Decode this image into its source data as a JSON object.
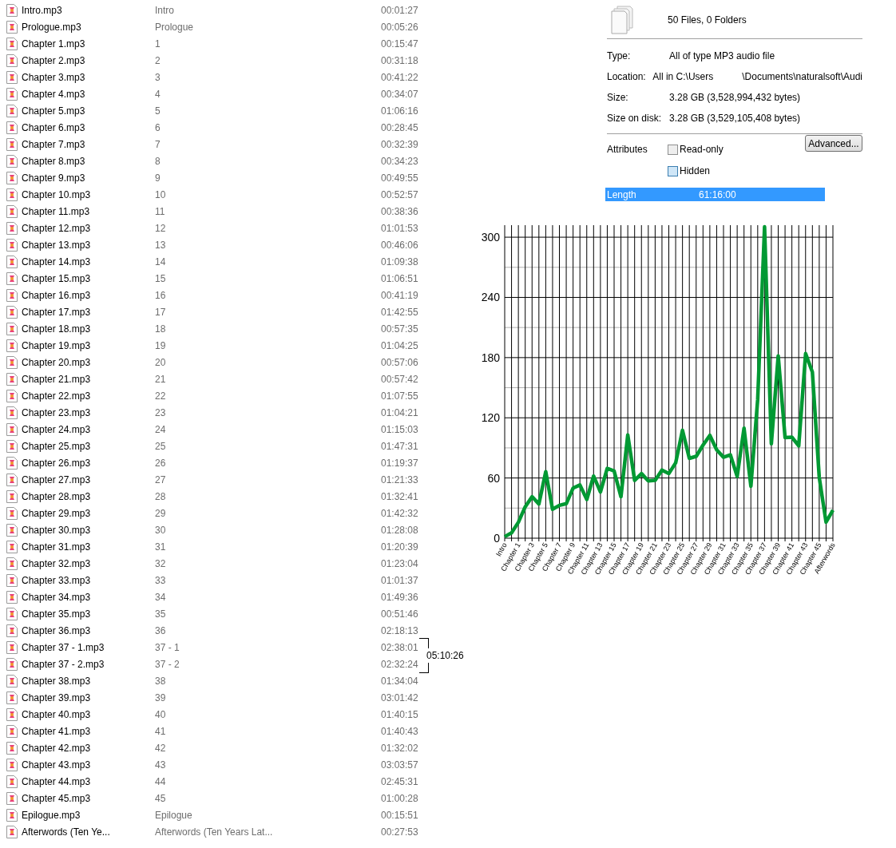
{
  "files": [
    {
      "name": "Intro.mp3",
      "title": "Intro",
      "length": "00:01:27"
    },
    {
      "name": "Prologue.mp3",
      "title": "Prologue",
      "length": "00:05:26"
    },
    {
      "name": "Chapter 1.mp3",
      "title": "1",
      "length": "00:15:47"
    },
    {
      "name": "Chapter 2.mp3",
      "title": "2",
      "length": "00:31:18"
    },
    {
      "name": "Chapter 3.mp3",
      "title": "3",
      "length": "00:41:22"
    },
    {
      "name": "Chapter 4.mp3",
      "title": "4",
      "length": "00:34:07"
    },
    {
      "name": "Chapter 5.mp3",
      "title": "5",
      "length": "01:06:16"
    },
    {
      "name": "Chapter 6.mp3",
      "title": "6",
      "length": "00:28:45"
    },
    {
      "name": "Chapter 7.mp3",
      "title": "7",
      "length": "00:32:39"
    },
    {
      "name": "Chapter 8.mp3",
      "title": "8",
      "length": "00:34:23"
    },
    {
      "name": "Chapter 9.mp3",
      "title": "9",
      "length": "00:49:55"
    },
    {
      "name": "Chapter 10.mp3",
      "title": "10",
      "length": "00:52:57"
    },
    {
      "name": "Chapter 11.mp3",
      "title": "11",
      "length": "00:38:36"
    },
    {
      "name": "Chapter 12.mp3",
      "title": "12",
      "length": "01:01:53"
    },
    {
      "name": "Chapter 13.mp3",
      "title": "13",
      "length": "00:46:06"
    },
    {
      "name": "Chapter 14.mp3",
      "title": "14",
      "length": "01:09:38"
    },
    {
      "name": "Chapter 15.mp3",
      "title": "15",
      "length": "01:06:51"
    },
    {
      "name": "Chapter 16.mp3",
      "title": "16",
      "length": "00:41:19"
    },
    {
      "name": "Chapter 17.mp3",
      "title": "17",
      "length": "01:42:55"
    },
    {
      "name": "Chapter 18.mp3",
      "title": "18",
      "length": "00:57:35"
    },
    {
      "name": "Chapter 19.mp3",
      "title": "19",
      "length": "01:04:25"
    },
    {
      "name": "Chapter 20.mp3",
      "title": "20",
      "length": "00:57:06"
    },
    {
      "name": "Chapter 21.mp3",
      "title": "21",
      "length": "00:57:42"
    },
    {
      "name": "Chapter 22.mp3",
      "title": "22",
      "length": "01:07:55"
    },
    {
      "name": "Chapter 23.mp3",
      "title": "23",
      "length": "01:04:21"
    },
    {
      "name": "Chapter 24.mp3",
      "title": "24",
      "length": "01:15:03"
    },
    {
      "name": "Chapter 25.mp3",
      "title": "25",
      "length": "01:47:31"
    },
    {
      "name": "Chapter 26.mp3",
      "title": "26",
      "length": "01:19:37"
    },
    {
      "name": "Chapter 27.mp3",
      "title": "27",
      "length": "01:21:33"
    },
    {
      "name": "Chapter 28.mp3",
      "title": "28",
      "length": "01:32:41"
    },
    {
      "name": "Chapter 29.mp3",
      "title": "29",
      "length": "01:42:32"
    },
    {
      "name": "Chapter 30.mp3",
      "title": "30",
      "length": "01:28:08"
    },
    {
      "name": "Chapter 31.mp3",
      "title": "31",
      "length": "01:20:39"
    },
    {
      "name": "Chapter 32.mp3",
      "title": "32",
      "length": "01:23:04"
    },
    {
      "name": "Chapter 33.mp3",
      "title": "33",
      "length": "01:01:37"
    },
    {
      "name": "Chapter 34.mp3",
      "title": "34",
      "length": "01:49:36"
    },
    {
      "name": "Chapter 35.mp3",
      "title": "35",
      "length": "00:51:46"
    },
    {
      "name": "Chapter 36.mp3",
      "title": "36",
      "length": "02:18:13"
    },
    {
      "name": "Chapter 37 - 1.mp3",
      "title": "37 - 1",
      "length": "02:38:01",
      "group_total": "05:10:26"
    },
    {
      "name": "Chapter 37 - 2.mp3",
      "title": "37 - 2",
      "length": "02:32:24"
    },
    {
      "name": "Chapter 38.mp3",
      "title": "38",
      "length": "01:34:04"
    },
    {
      "name": "Chapter 39.mp3",
      "title": "39",
      "length": "03:01:42"
    },
    {
      "name": "Chapter 40.mp3",
      "title": "40",
      "length": "01:40:15"
    },
    {
      "name": "Chapter 41.mp3",
      "title": "41",
      "length": "01:40:43"
    },
    {
      "name": "Chapter 42.mp3",
      "title": "42",
      "length": "01:32:02"
    },
    {
      "name": "Chapter 43.mp3",
      "title": "43",
      "length": "03:03:57"
    },
    {
      "name": "Chapter 44.mp3",
      "title": "44",
      "length": "02:45:31"
    },
    {
      "name": "Chapter 45.mp3",
      "title": "45",
      "length": "01:00:28"
    },
    {
      "name": "Epilogue.mp3",
      "title": "Epilogue",
      "length": "00:15:51"
    },
    {
      "name": "Afterwords (Ten Ye...",
      "title": "Afterwords (Ten Years Lat...",
      "length": "00:27:53"
    }
  ],
  "properties": {
    "summary": "50 Files, 0 Folders",
    "fields": [
      {
        "label": "Type:",
        "parts": [
          "All of type MP3 audio file"
        ]
      },
      {
        "label": "Location:",
        "parts": [
          "All in C:\\Users",
          "\\Documents\\naturalsoft\\Audi"
        ]
      },
      {
        "label": "Size:",
        "parts": [
          "3.28 GB (3,528,994,432 bytes)"
        ]
      },
      {
        "label": "Size on disk:",
        "parts": [
          "3.28 GB (3,529,105,408 bytes)"
        ]
      }
    ],
    "attributes_label": "Attributes",
    "checkboxes": [
      {
        "label": "Read-only",
        "checked": false,
        "focused": false
      },
      {
        "label": "Hidden",
        "checked": false,
        "focused": true
      }
    ],
    "advanced_button": "Advanced...",
    "length_row": {
      "label": "Length",
      "value": "61:16:00",
      "selected": true
    }
  },
  "chart": {
    "chart_data": {
      "type": "line",
      "categories": [
        "Intro",
        null,
        "Chapter 1",
        null,
        "Chapter 3",
        null,
        "Chapter 5",
        null,
        "Chapter 7",
        null,
        "Chapter 9",
        null,
        "Chapter 11",
        null,
        "Chapter 13",
        null,
        "Chapter 15",
        null,
        "Chapter 17",
        null,
        "Chapter 19",
        null,
        "Chapter 21",
        null,
        "Chapter 23",
        null,
        "Chapter 25",
        null,
        "Chapter 27",
        null,
        "Chapter 29",
        null,
        "Chapter 31",
        null,
        "Chapter 33",
        null,
        "Chapter 35",
        null,
        "Chapter 37",
        null,
        "Chapter 39",
        null,
        "Chapter 41",
        null,
        "Chapter 43",
        null,
        "Chapter 45",
        null,
        "Afterwords"
      ],
      "series": [
        {
          "color": "#009933",
          "values": [
            1.5,
            5.4,
            15.8,
            31.3,
            41.4,
            34.1,
            66.3,
            28.8,
            32.7,
            34.4,
            49.9,
            53.0,
            38.6,
            61.9,
            46.1,
            69.6,
            66.9,
            41.3,
            102.9,
            57.6,
            64.4,
            57.1,
            57.7,
            67.9,
            64.4,
            75.1,
            107.5,
            79.6,
            81.6,
            92.7,
            102.5,
            88.1,
            80.7,
            83.1,
            61.6,
            109.6,
            51.8,
            138.2,
            310.4,
            94.1,
            181.7,
            100.3,
            100.7,
            92.0,
            184.0,
            165.5,
            60.5,
            15.9,
            27.9
          ]
        }
      ],
      "ylim": [
        0,
        312
      ],
      "grid": true,
      "yticks": [
        0,
        60,
        120,
        180,
        240,
        300
      ]
    }
  }
}
